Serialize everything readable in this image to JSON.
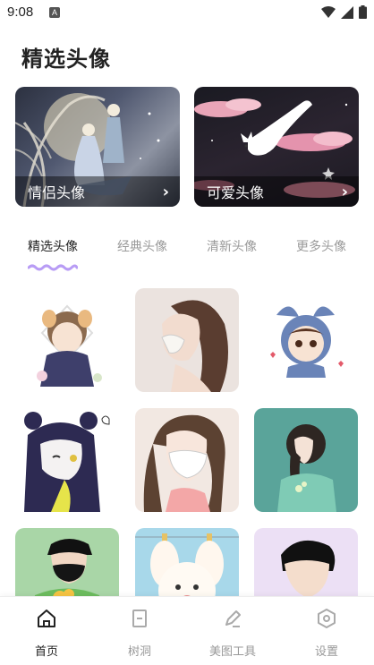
{
  "status_bar": {
    "time": "9:08",
    "notification_icon_letter": "A",
    "icons": [
      "wifi-icon",
      "signal-icon",
      "battery-icon"
    ]
  },
  "page_title": "精选头像",
  "categories": [
    {
      "label": "情侣头像",
      "arrow": "›",
      "icon": "chevron-right-icon"
    },
    {
      "label": "可爱头像",
      "arrow": "›",
      "icon": "chevron-right-icon"
    }
  ],
  "tabs": [
    {
      "label": "精选头像",
      "active": true
    },
    {
      "label": "经典头像",
      "active": false
    },
    {
      "label": "清新头像",
      "active": false
    },
    {
      "label": "更多头像",
      "active": false
    }
  ],
  "avatar_grid": [
    {
      "description_icon": "avatar-chibi-boy-dog-ears"
    },
    {
      "description_icon": "avatar-girl-mask-profile"
    },
    {
      "description_icon": "avatar-girl-bunny-hood"
    },
    {
      "description_icon": "avatar-anime-girl-bear-hood"
    },
    {
      "description_icon": "avatar-girl-white-mask"
    },
    {
      "description_icon": "avatar-girl-green-braid"
    },
    {
      "description_icon": "avatar-boy-cap-mask"
    },
    {
      "description_icon": "avatar-puppy-cartoon"
    },
    {
      "description_icon": "avatar-boy-black-hair"
    }
  ],
  "bottom_nav": [
    {
      "label": "首页",
      "icon": "home-icon",
      "active": true
    },
    {
      "label": "树洞",
      "icon": "bookmark-icon",
      "active": false
    },
    {
      "label": "美图工具",
      "icon": "pen-icon",
      "active": false
    },
    {
      "label": "设置",
      "icon": "settings-hex-icon",
      "active": false
    }
  ],
  "colors": {
    "accent": "#b89cf5",
    "active_text": "#222222",
    "inactive_text": "#9a9a9a"
  }
}
